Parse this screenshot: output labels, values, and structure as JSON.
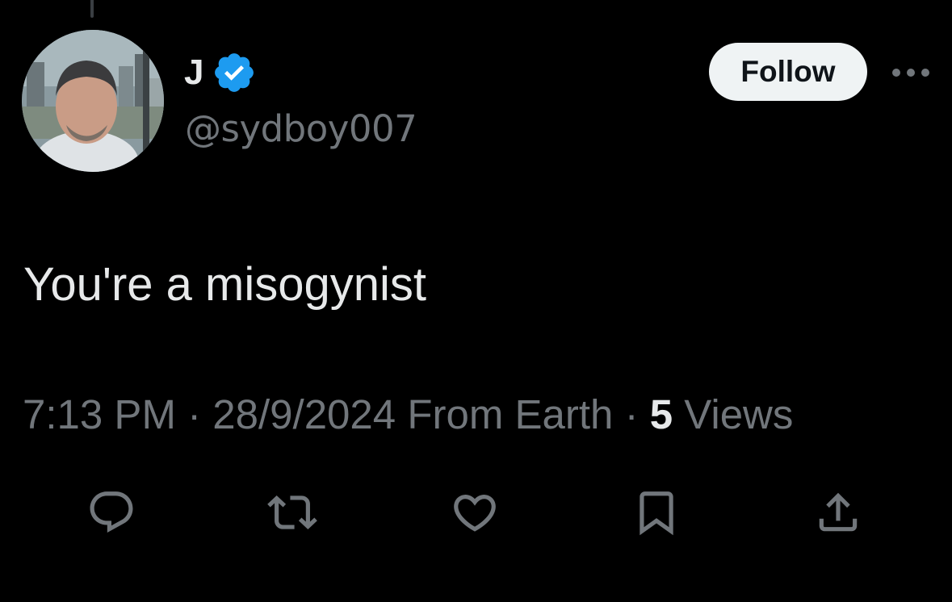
{
  "tweet": {
    "author": {
      "display_name": "J",
      "handle": "@sydboy007",
      "avatar_icon": "profile-photo",
      "verified_icon": "verified-badge-icon",
      "verified_color": "#1d9bf0"
    },
    "follow_label": "Follow",
    "more_icon": "more-horizontal-icon",
    "text": "You're a misogynist",
    "meta": {
      "time": "7:13 PM",
      "separator": "·",
      "date": "28/9/2024",
      "source": "From Earth",
      "views_count": "5",
      "views_label": "Views"
    },
    "actions": [
      {
        "name": "reply",
        "icon": "reply-icon"
      },
      {
        "name": "retweet",
        "icon": "retweet-icon"
      },
      {
        "name": "like",
        "icon": "heart-icon"
      },
      {
        "name": "bookmark",
        "icon": "bookmark-icon"
      },
      {
        "name": "share",
        "icon": "share-icon"
      }
    ]
  },
  "colors": {
    "background": "#000000",
    "primary_text": "#e7e9ea",
    "secondary_text": "#71767b",
    "follow_bg": "#eff3f4",
    "accent": "#1d9bf0"
  }
}
